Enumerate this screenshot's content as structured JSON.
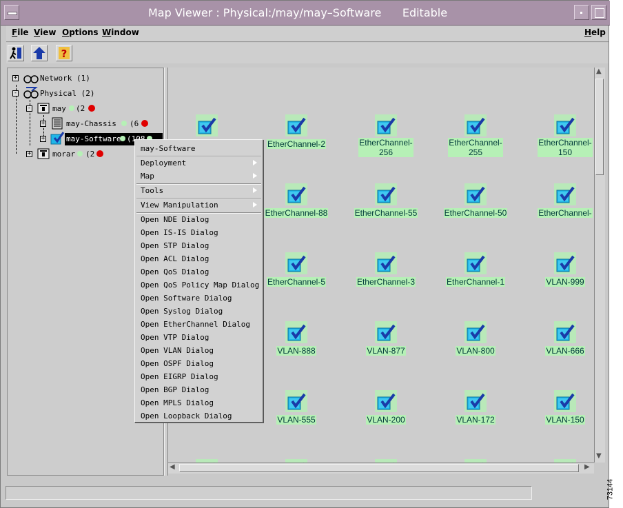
{
  "window": {
    "title": "Map Viewer : Physical:/may/may–Software      Editable"
  },
  "menubar": {
    "items": [
      "File",
      "View",
      "Options",
      "Window"
    ],
    "help": "Help"
  },
  "toolbar": {
    "icons": [
      "exit-icon",
      "up-arrow-icon",
      "help-icon"
    ]
  },
  "tree": {
    "nodes": [
      {
        "label": "Network (1)",
        "icon": "network-icon"
      },
      {
        "label": "Physical (2)",
        "icon": "physical-icon"
      },
      {
        "label": "may",
        "count": "(2",
        "icon": "switch-icon"
      },
      {
        "label": "may-Chassis",
        "count": "(6",
        "icon": "chassis-icon"
      },
      {
        "label": "may-Software",
        "count": "(108",
        "icon": "software-icon"
      },
      {
        "label": "morar",
        "count": "(2",
        "icon": "switch-icon"
      }
    ]
  },
  "context_menu": {
    "header": "may-Software",
    "submenus": [
      "Deployment",
      "Map",
      "Tools",
      "View Manipulation"
    ],
    "items": [
      "Open NDE Dialog",
      "Open IS-IS Dialog",
      "Open STP Dialog",
      "Open ACL Dialog",
      "Open QoS Dialog",
      "Open QoS Policy Map Dialog",
      "Open Software Dialog",
      "Open Syslog Dialog",
      "Open EtherChannel Dialog",
      "Open VTP Dialog",
      "Open VLAN Dialog",
      "Open OSPF Dialog",
      "Open EIGRP Dialog",
      "Open BGP Dialog",
      "Open MPLS Dialog",
      "Open Loopback Dialog"
    ]
  },
  "map": {
    "devices": [
      [
        "",
        "EtherChannel-2",
        "EtherChannel-\n256",
        "EtherChannel-\n255",
        "EtherChannel-\n150"
      ],
      [
        "",
        "EtherChannel-88",
        "EtherChannel-55",
        "EtherChannel-50",
        "EtherChannel-"
      ],
      [
        "",
        "EtherChannel-5",
        "EtherChannel-3",
        "EtherChannel-1",
        "VLAN-999"
      ],
      [
        "",
        "VLAN-888",
        "VLAN-877",
        "VLAN-800",
        "VLAN-666"
      ],
      [
        "",
        "VLAN-555",
        "VLAN-200",
        "VLAN-172",
        "VLAN-150"
      ]
    ]
  },
  "colors": {
    "titlebar": "#a892a8",
    "label_bg": "#b6f0b6",
    "alarm": "#e00000"
  },
  "figure_id": "73144"
}
